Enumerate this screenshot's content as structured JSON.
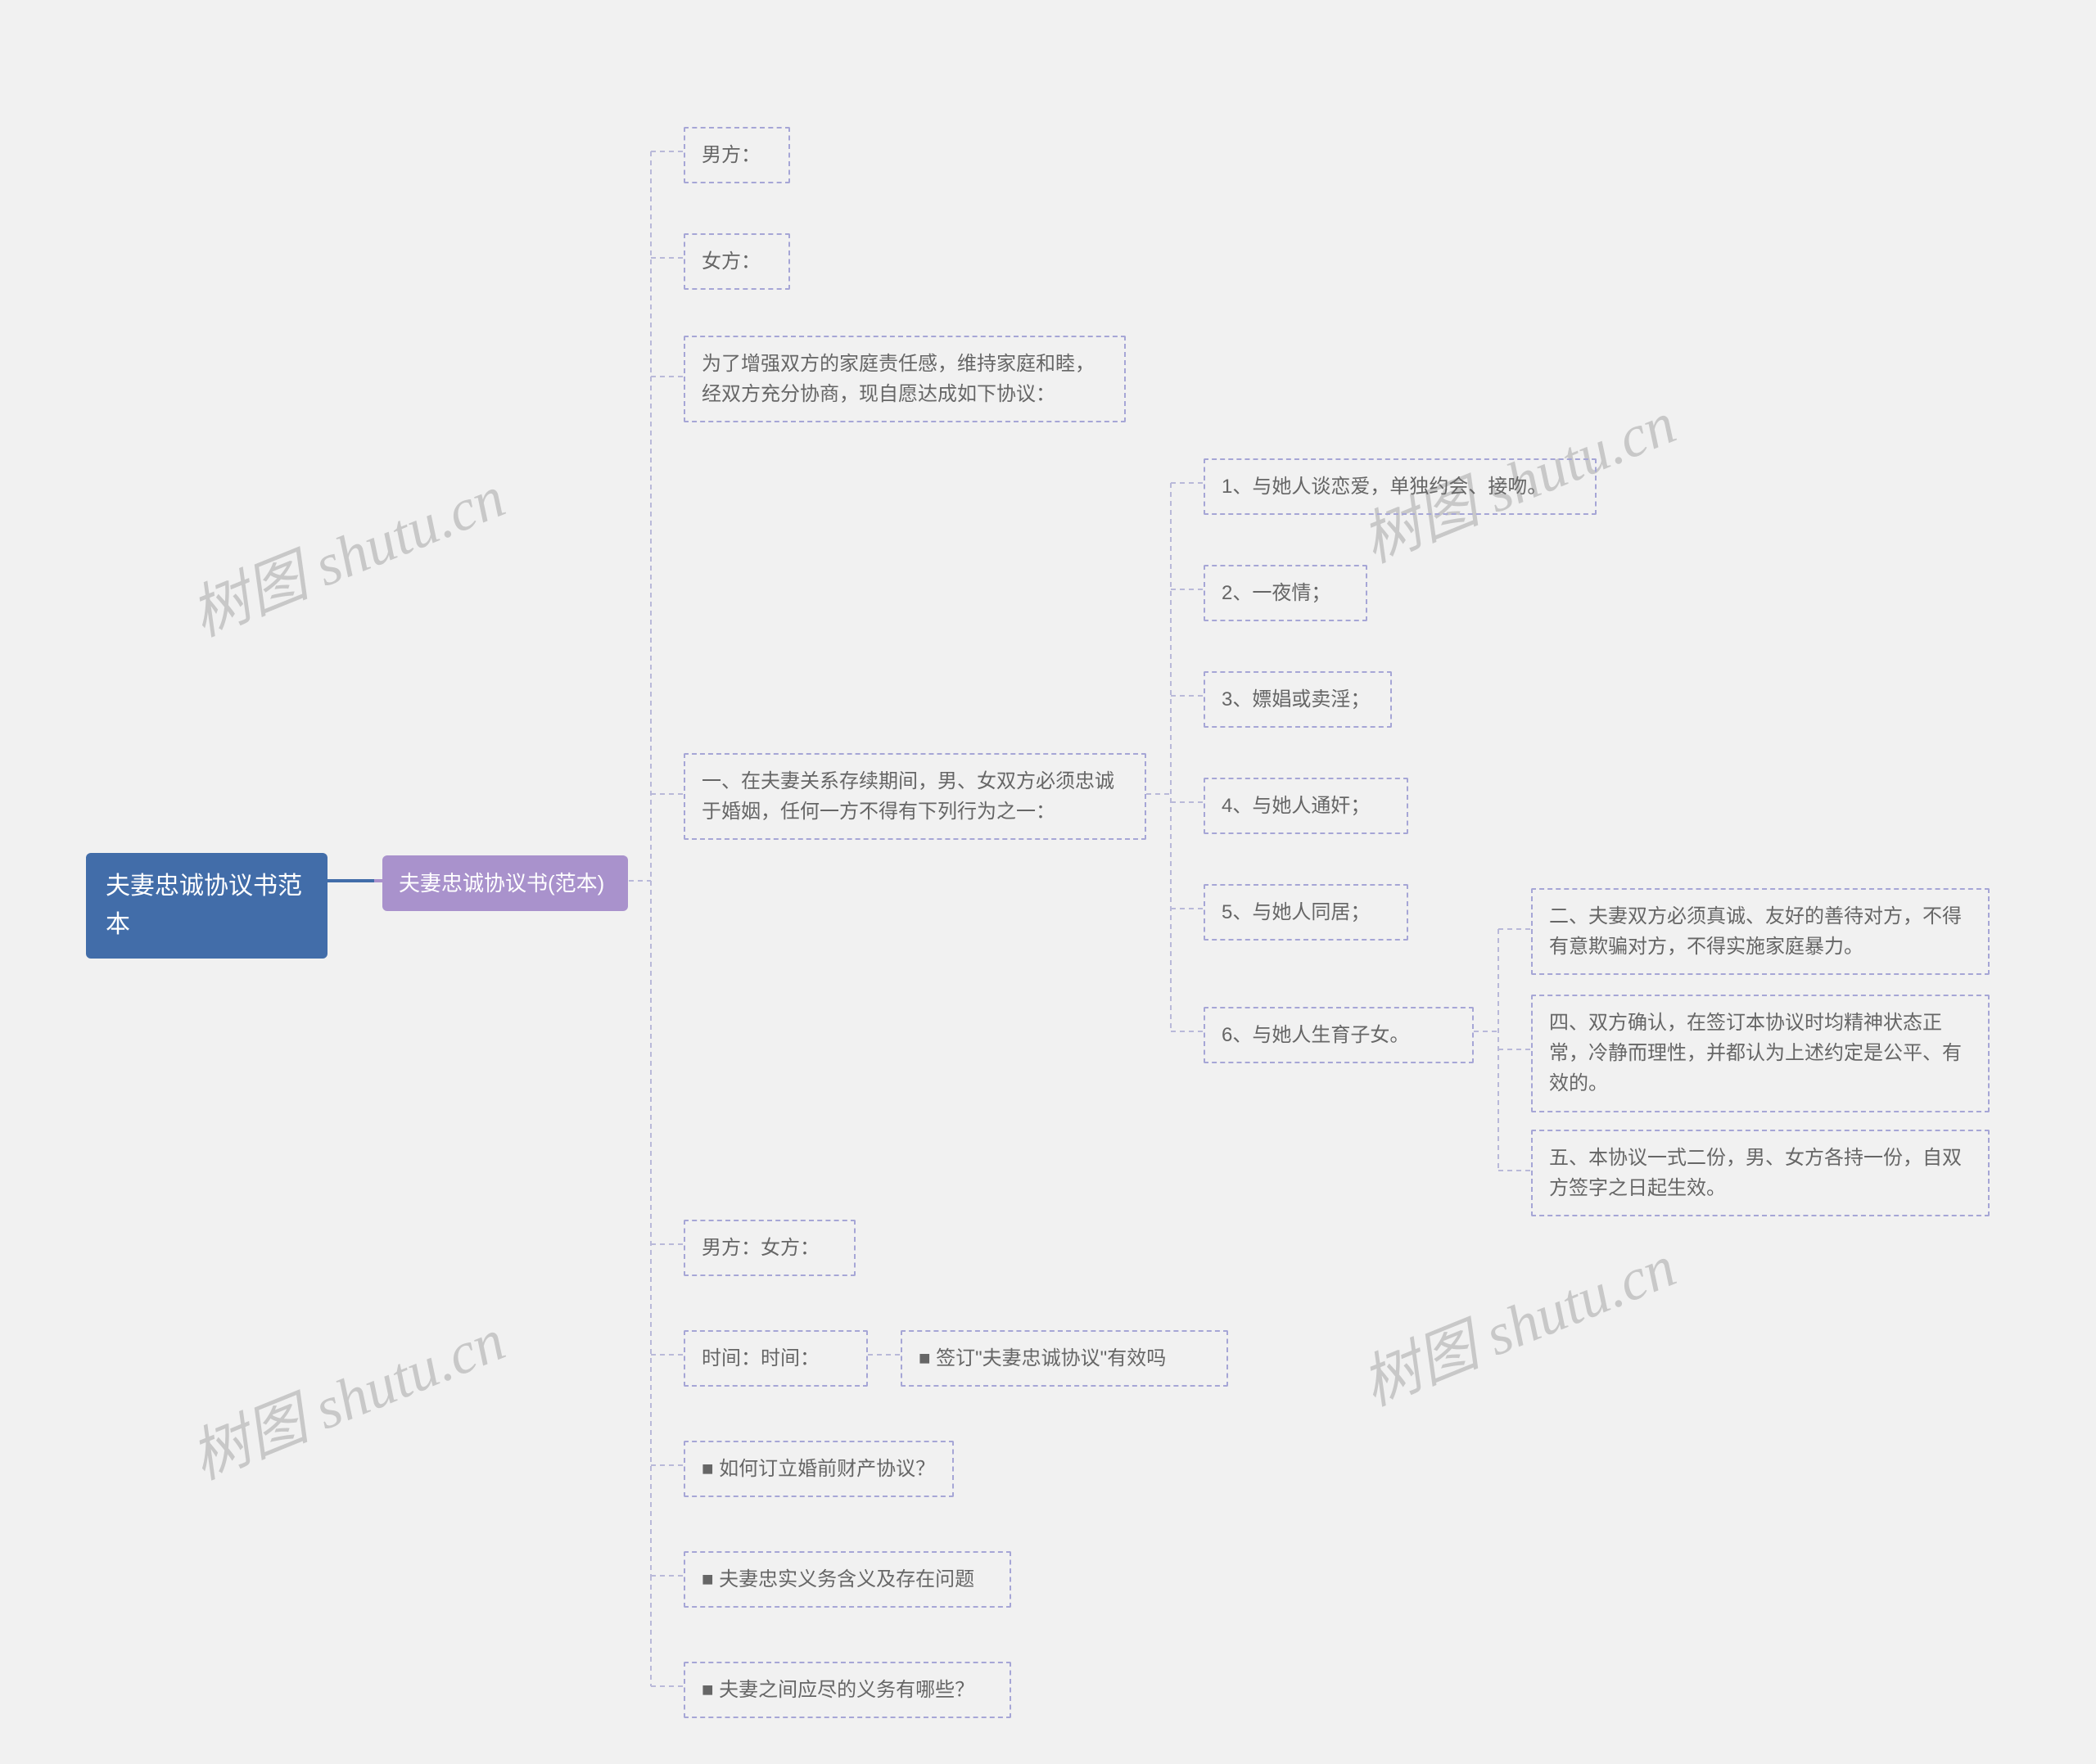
{
  "watermark_text": "树图 shutu.cn",
  "root": {
    "label": "夫妻忠诚协议书范本"
  },
  "level1": {
    "label": "夫妻忠诚协议书(范本)"
  },
  "l2": {
    "male": "男方：",
    "female": "女方：",
    "preamble": "为了增强双方的家庭责任感，维持家庭和睦，经双方充分协商，现自愿达成如下协议：",
    "clause1": "一、在夫妻关系存续期间，男、女双方必须忠诚于婚姻，任何一方不得有下列行为之一：",
    "sign": "男方：女方：",
    "time": "时间：时间：",
    "q1": "■ 如何订立婚前财产协议？",
    "q2": "■ 夫妻忠实义务含义及存在问题",
    "q3": "■ 夫妻之间应尽的义务有哪些？"
  },
  "l3": {
    "i1": "1、与她人谈恋爱，单独约会、接吻。",
    "i2": "2、一夜情；",
    "i3": "3、嫖娼或卖淫；",
    "i4": "4、与她人通奸；",
    "i5": "5、与她人同居；",
    "i6": "6、与她人生育子女。",
    "time_valid": "■ 签订\"夫妻忠诚协议\"有效吗"
  },
  "l4": {
    "c2": "二、夫妻双方必须真诚、友好的善待对方，不得有意欺骗对方，不得实施家庭暴力。",
    "c4": "四、双方确认，在签订本协议时均精神状态正常，冷静而理性，并都认为上述约定是公平、有效的。",
    "c5": "五、本协议一式二份，男、女方各持一份，自双方签字之日起生效。"
  }
}
